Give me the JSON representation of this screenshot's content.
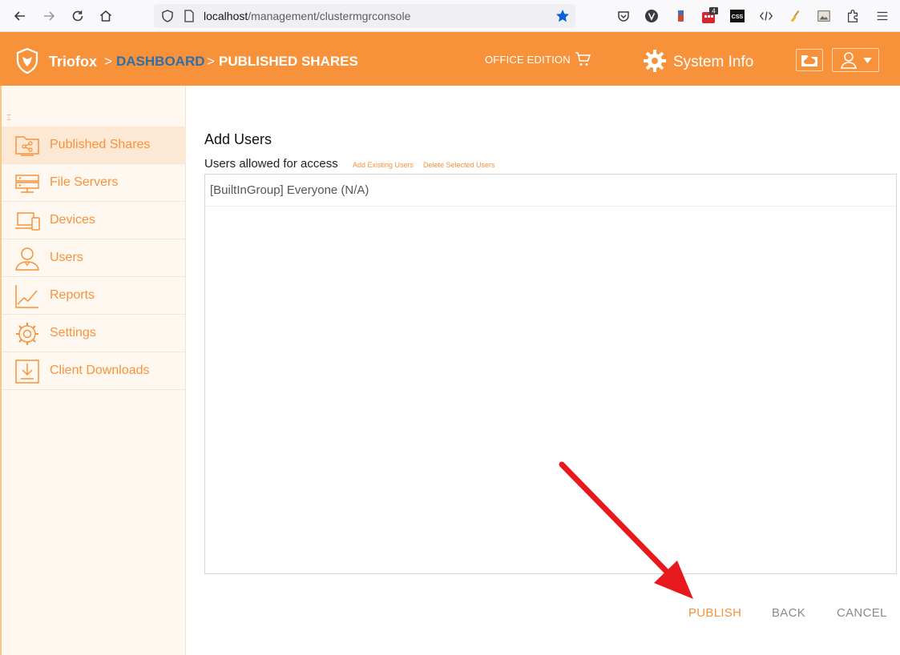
{
  "browser": {
    "url_host": "localhost",
    "url_path": "/management/clustermgrconsole",
    "ext_badge": "4",
    "ext_css_label": "CSS"
  },
  "header": {
    "brand": "Triofox",
    "crumb_sep": ">",
    "crumb_dashboard": "DASHBOARD",
    "crumb_current": "PUBLISHED SHARES",
    "edition": "OFFICE EDITION",
    "system_info": "System Info"
  },
  "sidebar": {
    "collapse_mark": "⌶",
    "items": [
      {
        "label": "Published Shares",
        "icon": "share-folder-icon",
        "active": true
      },
      {
        "label": "File Servers",
        "icon": "server-icon"
      },
      {
        "label": "Devices",
        "icon": "devices-icon"
      },
      {
        "label": "Users",
        "icon": "user-icon"
      },
      {
        "label": "Reports",
        "icon": "chart-icon"
      },
      {
        "label": "Settings",
        "icon": "gear-icon"
      },
      {
        "label": "Client Downloads",
        "icon": "download-icon"
      }
    ]
  },
  "main": {
    "title": "Add Users",
    "users_label": "Users allowed for access",
    "add_existing": "Add Existing Users",
    "delete_selected": "Delete Selected Users",
    "users": [
      "[BuiltInGroup] Everyone (N/A)"
    ],
    "publish": "PUBLISH",
    "back": "BACK",
    "cancel": "CANCEL"
  },
  "colors": {
    "accent": "#f7923a",
    "dashboard_link": "#2e6fa8",
    "arrow": "#e8191c"
  }
}
